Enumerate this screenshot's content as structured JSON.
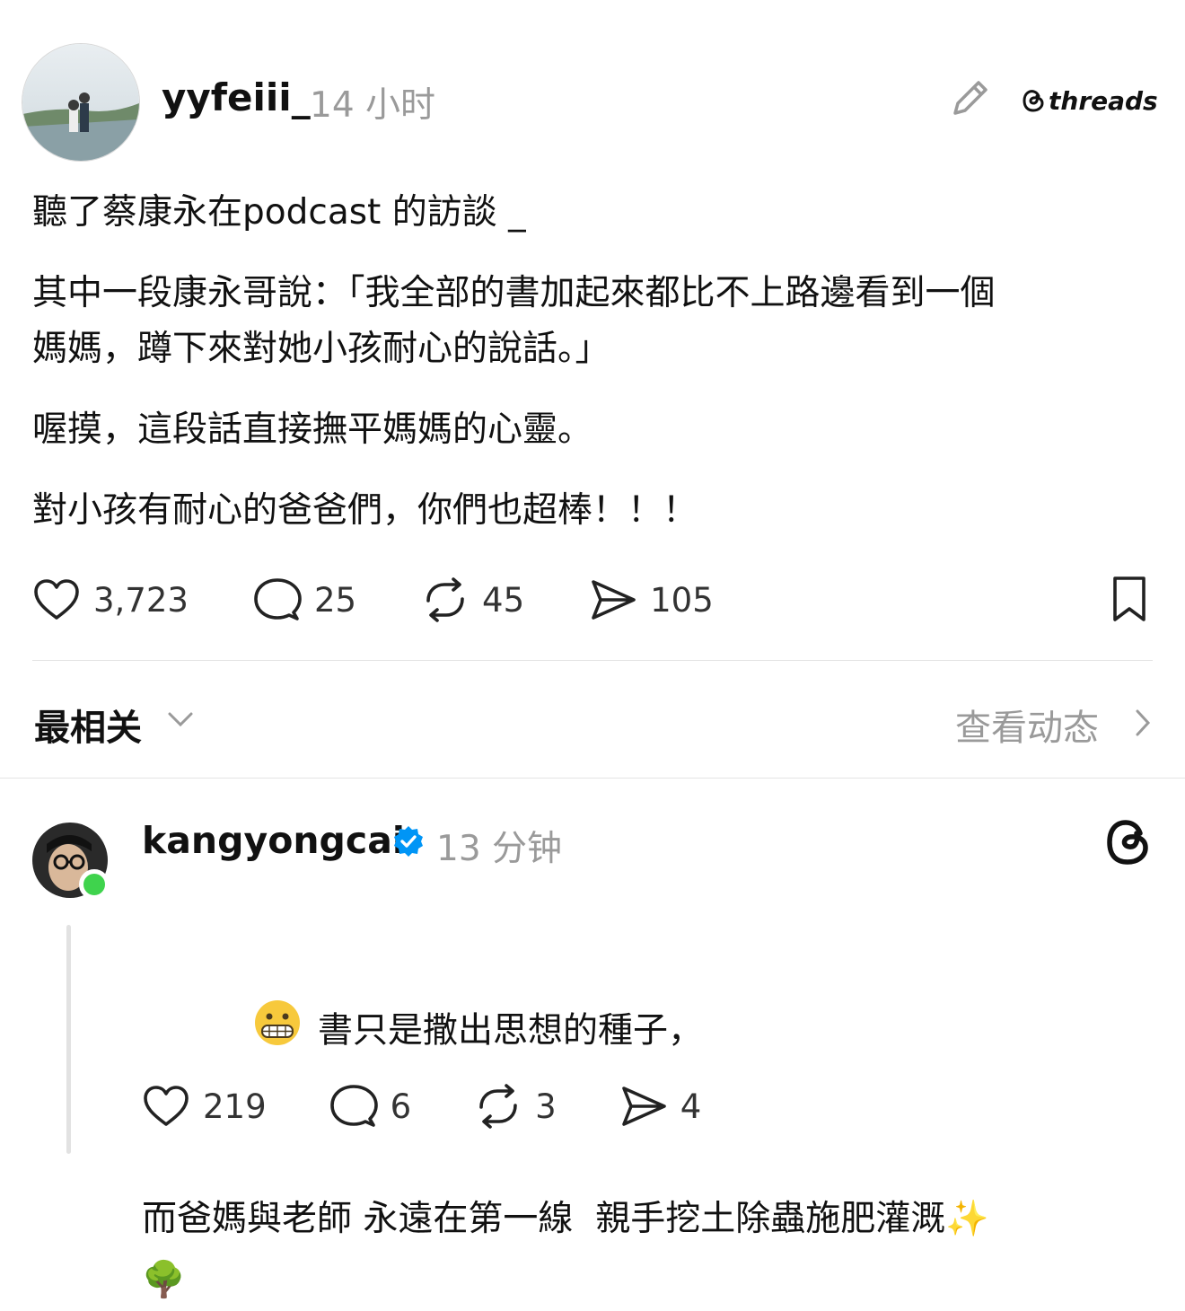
{
  "post": {
    "username": "yyfeiii_",
    "timestamp": "14 小时",
    "brand": "threads",
    "paragraphs": [
      "聽了蔡康永在podcast 的訪談 _",
      "其中一段康永哥說：「我全部的書加起來都比不上路邊看到一個\n媽媽，蹲下來對她小孩耐心的說話。」",
      "喔摸，這段話直接撫平媽媽的心靈。",
      "對小孩有耐心的爸爸們，你們也超棒！！！"
    ],
    "likes": "3,723",
    "comments": "25",
    "reposts": "45",
    "shares": "105"
  },
  "sort": {
    "label": "最相关",
    "view_activity": "查看动态"
  },
  "reply": {
    "username": "kangyongcai",
    "timestamp": "13 分钟",
    "line1": "書只是撒出思想的種子，",
    "line2": "而爸媽與老師 永遠在第一線  親手挖土除蟲施肥灌溉✨",
    "line3": "🌳",
    "likes": "219",
    "comments": "6",
    "reposts": "3",
    "shares": "4"
  },
  "icons": [
    "heart-icon",
    "comment-icon",
    "repost-icon",
    "share-icon",
    "bookmark-icon",
    "edit-icon",
    "threads-icon",
    "verified-icon",
    "chevron-down-icon",
    "chevron-right-icon"
  ],
  "colors": {
    "text": "#101010",
    "muted": "#9a9a9a",
    "verified": "#0095f6",
    "online": "#3fd34d"
  }
}
